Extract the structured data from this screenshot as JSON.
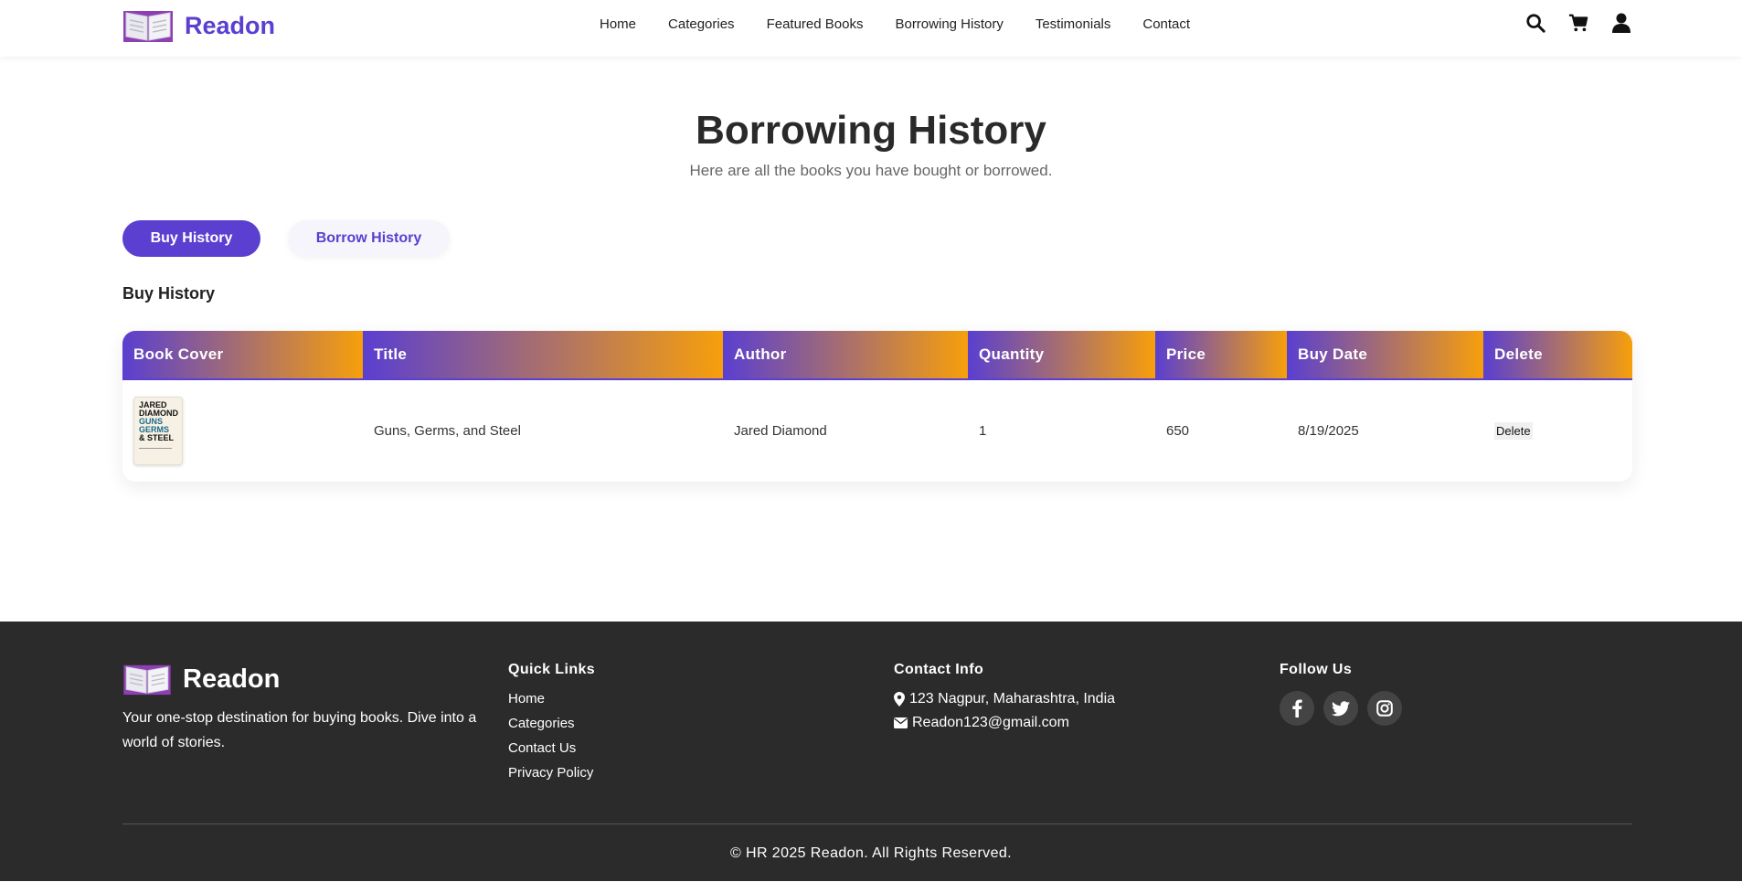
{
  "brand": {
    "name": "Readon",
    "accent": "#5a3fd0"
  },
  "nav": [
    "Home",
    "Categories",
    "Featured Books",
    "Borrowing History",
    "Testimonials",
    "Contact"
  ],
  "header_icons": [
    "search-icon",
    "cart-icon",
    "user-icon"
  ],
  "hero": {
    "title": "Borrowing History",
    "subtitle": "Here are all the books you have bought or borrowed."
  },
  "tabs": {
    "buy": "Buy History",
    "borrow": "Borrow History",
    "active": "buy"
  },
  "section_title": "Buy History",
  "table": {
    "headers": [
      "Book Cover",
      "Title",
      "Author",
      "Quantity",
      "Price",
      "Buy Date",
      "Delete"
    ],
    "rows": [
      {
        "cover": {
          "lines": [
            "JARED",
            "DIAMOND",
            "GUNS",
            "GERMS",
            "& STEEL"
          ]
        },
        "title": "Guns, Germs, and Steel",
        "author": "Jared Diamond",
        "quantity": "1",
        "price": "650",
        "buy_date": "8/19/2025",
        "delete_label": "Delete"
      }
    ],
    "gradient": [
      "#5a3fd0",
      "#f79f0b"
    ]
  },
  "footer": {
    "brand_name": "Readon",
    "tagline": "Your one-stop destination for buying books. Dive into a world of stories.",
    "quick_links": {
      "title": "Quick Links",
      "items": [
        "Home",
        "Categories",
        "Contact Us",
        "Privacy Policy"
      ]
    },
    "contact": {
      "title": "Contact Info",
      "address": "123 Nagpur, Maharashtra, India",
      "email": "Readon123@gmail.com"
    },
    "follow": {
      "title": "Follow Us",
      "icons": [
        "facebook-icon",
        "twitter-icon",
        "instagram-icon"
      ]
    },
    "copyright": "© HR 2025 Readon. All Rights Reserved.",
    "bg": "#2b2b2b"
  }
}
